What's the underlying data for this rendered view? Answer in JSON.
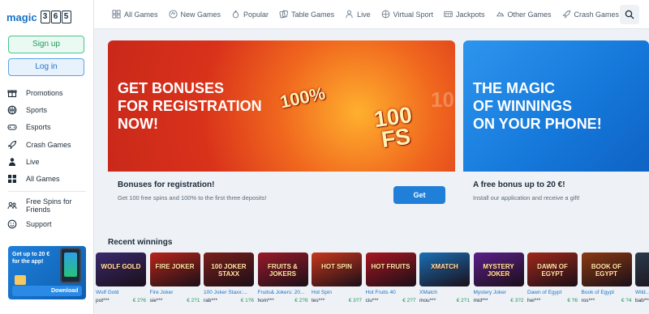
{
  "brand": {
    "text": "magic",
    "digits": [
      "3",
      "6",
      "5"
    ]
  },
  "sidebar": {
    "signup_label": "Sign up",
    "login_label": "Log in",
    "items": [
      {
        "label": "Promotions",
        "icon": "gift-icon"
      },
      {
        "label": "Sports",
        "icon": "ball-icon"
      },
      {
        "label": "Esports",
        "icon": "gamepad-icon"
      },
      {
        "label": "Crash Games",
        "icon": "rocket-icon"
      },
      {
        "label": "Live",
        "icon": "dealer-icon"
      },
      {
        "label": "All Games",
        "icon": "grid-icon"
      },
      {
        "label": "Free Spins for Friends",
        "icon": "friends-icon"
      },
      {
        "label": "Support",
        "icon": "support-icon"
      }
    ],
    "promo": {
      "text": "Get up to 20 € for the app!",
      "button": "Download"
    }
  },
  "topnav": {
    "items": [
      {
        "label": "All Games",
        "icon": "grid-icon"
      },
      {
        "label": "New Games",
        "icon": "new-icon"
      },
      {
        "label": "Popular",
        "icon": "fire-icon"
      },
      {
        "label": "Table Games",
        "icon": "cards-icon"
      },
      {
        "label": "Live",
        "icon": "dealer-icon"
      },
      {
        "label": "Virtual Sport",
        "icon": "ball-icon"
      },
      {
        "label": "Jackpots",
        "icon": "jackpot-icon"
      },
      {
        "label": "Other Games",
        "icon": "other-icon"
      },
      {
        "label": "Crash Games",
        "icon": "rocket-icon"
      }
    ]
  },
  "banners": [
    {
      "headline": "GET BONUSES\nFOR REGISTRATION\nNOW!",
      "badge_percent": "100%",
      "badge_fs": "100\nFS",
      "title": "Bonuses for registration!",
      "subtitle": "Get 100 free spins and 100% to the first three deposits!",
      "button": "Get"
    },
    {
      "headline": "THE MAGIC\nOF WINNINGS\nON YOUR PHONE!",
      "title": "A free bonus up to 20 €!",
      "subtitle": "Install our application and receive a gift!"
    }
  ],
  "recent": {
    "title": "Recent winnings",
    "items": [
      {
        "game": "Wolf Gold",
        "thumb": "WOLF GOLD",
        "user": "pot***",
        "amount": "€ 2?6",
        "color": "#3a2a6e"
      },
      {
        "game": "Fire Joker",
        "thumb": "FIRE JOKER",
        "user": "sie***",
        "amount": "€ 2?1",
        "color": "#b7251a"
      },
      {
        "game": "100 Joker Staxx:...",
        "thumb": "100 JOKER STAXX",
        "user": "rab***",
        "amount": "€ 1?6",
        "color": "#7a1f1a"
      },
      {
        "game": "Fruits& Jokers: 20...",
        "thumb": "FRUITS & JOKERS",
        "user": "hom***",
        "amount": "€ 2?8",
        "color": "#9a1a2a"
      },
      {
        "game": "Hot Spin",
        "thumb": "HOT SPIN",
        "user": "tes***",
        "amount": "€ 3?7",
        "color": "#c8371c"
      },
      {
        "game": "Hot Fruits 40",
        "thumb": "HOT FRUITS",
        "user": "ciu***",
        "amount": "€ 2?7",
        "color": "#a81620"
      },
      {
        "game": "XMatch",
        "thumb": "XMATCH",
        "user": "mou***",
        "amount": "€ 2?1",
        "color": "#1a6fb5"
      },
      {
        "game": "Mystery Joker",
        "thumb": "MYSTERY JOKER",
        "user": "mid***",
        "amount": "€ 3?2",
        "color": "#5b1f8a"
      },
      {
        "game": "Dawn of Egypt",
        "thumb": "DAWN OF EGYPT",
        "user": "hei***",
        "amount": "€ ?6",
        "color": "#a0281a"
      },
      {
        "game": "Book of Egypt",
        "thumb": "BOOK OF EGYPT",
        "user": "ros***",
        "amount": "€ ?4",
        "color": "#8a3a12"
      },
      {
        "game": "Wild...",
        "thumb": "",
        "user": "bab***",
        "amount": "",
        "color": "#2a3a4a"
      }
    ]
  },
  "colors": {
    "accent": "#1f7fd9",
    "signup_green": "#22995c",
    "banner_red": "#d9321b",
    "banner_blue": "#1477d9"
  }
}
